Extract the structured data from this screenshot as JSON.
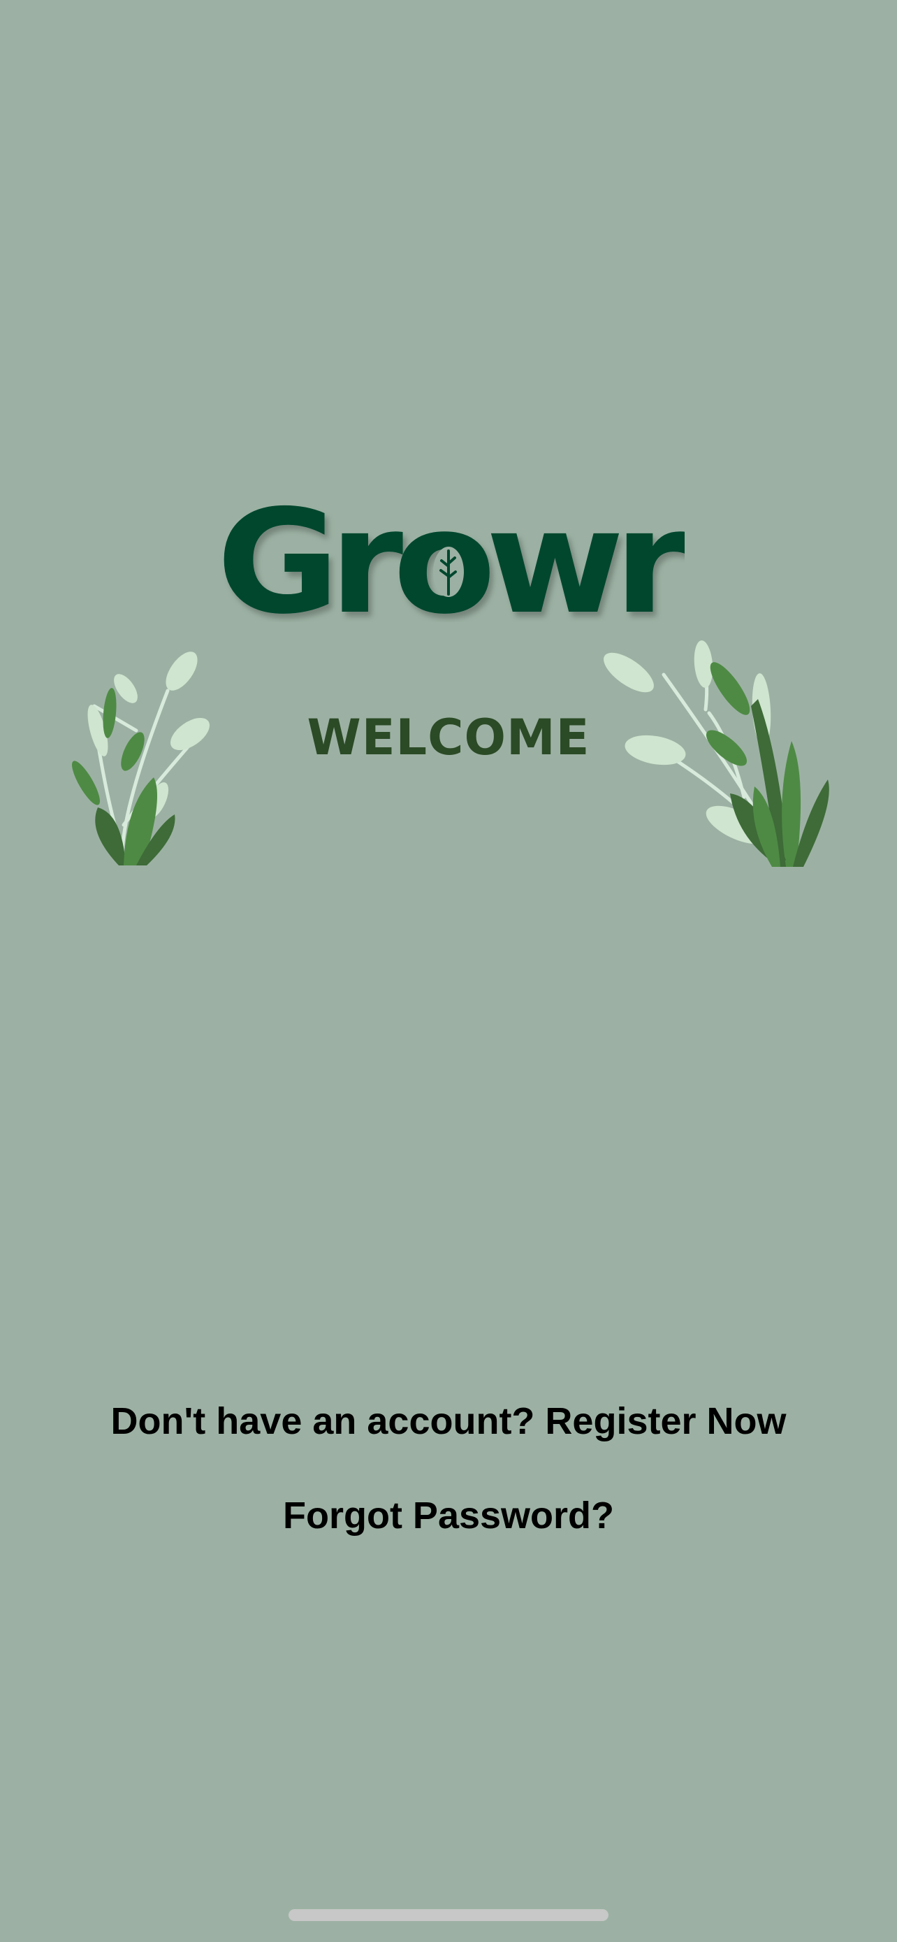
{
  "app": {
    "logo_text": "Growr",
    "welcome": "WELCOME"
  },
  "links": {
    "register": "Don't have an account? Register Now",
    "forgot_password": "Forgot Password?"
  },
  "colors": {
    "background": "#9cb1a3",
    "logo": "#00472f",
    "welcome": "#2b4a26",
    "leaf_dark": "#3e6b38",
    "leaf_mid": "#4e8a44",
    "leaf_light": "#cfe5cf",
    "link_text": "#000000",
    "home_indicator": "#c7c8c7"
  },
  "icons": {
    "logo_leaf": "leaf-icon",
    "left_plant": "plant-illustration",
    "right_plant": "plant-illustration"
  }
}
